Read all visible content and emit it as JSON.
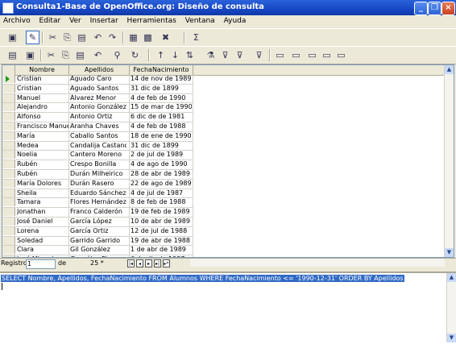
{
  "window": {
    "title": "Consulta1-Base de OpenOffice.org: Diseño de consulta"
  },
  "menu": [
    "Archivo",
    "Editar",
    "Ver",
    "Insertar",
    "Herramientas",
    "Ventana",
    "Ayuda"
  ],
  "grid": {
    "columns": [
      "Nombre",
      "Apellidos",
      "FechaNacimiento"
    ],
    "rows": [
      [
        "Cristian",
        "Aguado Caro",
        "14 de nov de 1989"
      ],
      [
        "Cristian",
        "Aguado Santos",
        "31 dic de 1899"
      ],
      [
        "Manuel",
        "Álvarez Menor",
        "4 de feb de 1990"
      ],
      [
        "Alejandro",
        "Antonio González",
        "15 de mar de 1990"
      ],
      [
        "Alfonso",
        "Antonio Ortiz",
        "6 dic de de 1981"
      ],
      [
        "Francisco Manuel",
        "Aranha Chaves",
        "4 de feb de 1988"
      ],
      [
        "María",
        "Caballo Santos",
        "18 de ene de 1990"
      ],
      [
        "Medea",
        "Candalija Castano",
        "31 dic de 1899"
      ],
      [
        "Noelia",
        "Cantero Moreno",
        "2 de jul de 1989"
      ],
      [
        "Rubén",
        "Crespo Bonilla",
        "4 de ago de 1990"
      ],
      [
        "Rubén",
        "Durán Milheirico",
        "28 de abr de 1989"
      ],
      [
        "María Dolores",
        "Durán Rasero",
        "22 de ago de 1989"
      ],
      [
        "Sheila",
        "Eduardo Sánchez",
        "4 de jul de 1987"
      ],
      [
        "Tamara",
        "Flores Hernández",
        "8 de feb de 1988"
      ],
      [
        "Jonathan",
        "Franco Calderón",
        "19 de feb de 1989"
      ],
      [
        "José Daniel",
        "García López",
        "10 de abr de 1989"
      ],
      [
        "Lorena",
        "García Ortiz",
        "12 de jul de 1988"
      ],
      [
        "Soledad",
        "Garrido Garrido",
        "19 de abr de 1988"
      ],
      [
        "Clara",
        "Gil González",
        "1 de abr de 1989"
      ],
      [
        "José Miguel",
        "González Flores",
        "6 de dic de 1987"
      ],
      [
        "Juan Diego",
        "González Pulido",
        "23 de ago de 1990"
      ]
    ]
  },
  "navigation": {
    "label": "Registro",
    "record": "1",
    "of_label": "de",
    "total": "25 *"
  },
  "sql": "SELECT Nombre, Apellidos, FechaNacimiento FROM Alumnos WHERE FechaNacimiento <= '1990-12-31' ORDER BY Apellidos"
}
